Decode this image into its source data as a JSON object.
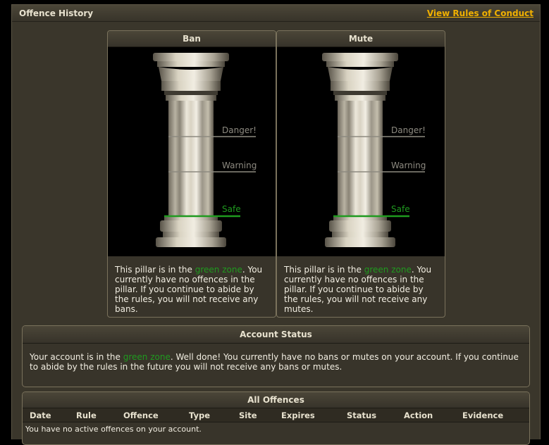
{
  "header": {
    "title": "Offence History",
    "rules_link": "View Rules of Conduct"
  },
  "pillars": [
    {
      "title": "Ban",
      "levels": {
        "danger": "Danger!",
        "warning": "Warning",
        "safe": "Safe"
      },
      "text_before": "This pillar is in the ",
      "zone": "green zone",
      "text_after": ". You currently have no offences in the pillar. If you continue to abide by the rules, you will not receive any bans."
    },
    {
      "title": "Mute",
      "levels": {
        "danger": "Danger!",
        "warning": "Warning",
        "safe": "Safe"
      },
      "text_before": "This pillar is in the ",
      "zone": "green zone",
      "text_after": ". You currently have no offences in the pillar. If you continue to abide by the rules, you will not receive any mutes."
    }
  ],
  "account_status": {
    "title": "Account Status",
    "text_before": "Your account is in the ",
    "zone": "green zone",
    "text_after": ". Well done! You currently have no bans or mutes on your account. If you continue to abide by the rules in the future you will not receive any bans or mutes."
  },
  "offences": {
    "title": "All Offences",
    "columns": [
      "Date",
      "Rule",
      "Offence",
      "Type",
      "Site",
      "Expires",
      "Status",
      "Action",
      "Evidence"
    ],
    "empty_text": "You have no active offences on your account."
  },
  "colors": {
    "accent_link": "#f0b000",
    "safe_green": "#1f9a1f",
    "panel_bg": "#38342a"
  }
}
